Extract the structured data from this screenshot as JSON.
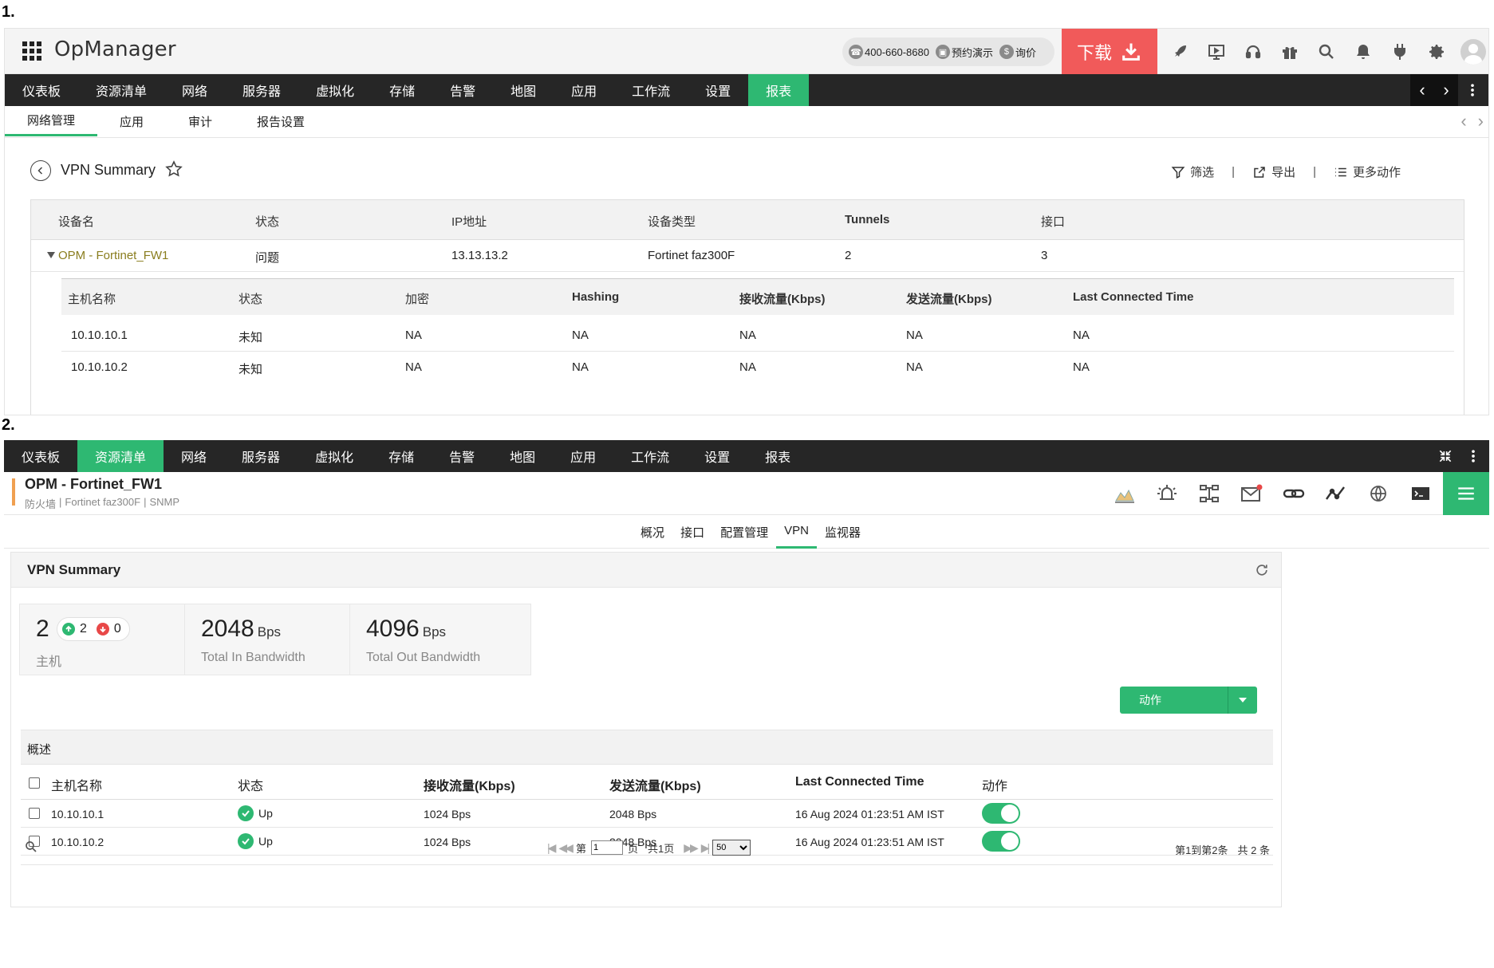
{
  "section_labels": {
    "first": "1.",
    "second": "2."
  },
  "app": {
    "title": "OpManager"
  },
  "contact": {
    "phone": "400-660-8680",
    "demo": "预约演示",
    "price": "询价"
  },
  "download": {
    "label": "下载"
  },
  "nav": {
    "items": [
      "仪表板",
      "资源清单",
      "网络",
      "服务器",
      "虚拟化",
      "存储",
      "告警",
      "地图",
      "应用",
      "工作流",
      "设置",
      "报表"
    ],
    "active_first": "报表",
    "active_second": "资源清单"
  },
  "subnav": {
    "items": [
      "网络管理",
      "应用",
      "审计",
      "报告设置"
    ],
    "active": "网络管理"
  },
  "vpn_page": {
    "title": "VPN Summary",
    "filter": "筛选",
    "export": "导出",
    "more": "更多动作",
    "columns": [
      "设备名",
      "状态",
      "IP地址",
      "设备类型",
      "Tunnels",
      "接口"
    ],
    "device": {
      "name": "OPM - Fortinet_FW1",
      "status": "问题",
      "ip": "13.13.13.2",
      "type": "Fortinet faz300F",
      "tunnels": "2",
      "interfaces": "3"
    },
    "sub_columns": [
      "主机名称",
      "状态",
      "加密",
      "Hashing",
      "接收流量(Kbps)",
      "发送流量(Kbps)",
      "Last Connected Time"
    ],
    "sub_rows": [
      [
        "10.10.10.1",
        "未知",
        "NA",
        "NA",
        "NA",
        "NA",
        "NA"
      ],
      [
        "10.10.10.2",
        "未知",
        "NA",
        "NA",
        "NA",
        "NA",
        "NA"
      ]
    ]
  },
  "device_page": {
    "title": "OPM - Fortinet_FW1",
    "category": "防火墙",
    "model": "Fortinet faz300F",
    "protocol": "SNMP",
    "tabs": [
      "概况",
      "接口",
      "配置管理",
      "VPN",
      "监视器"
    ],
    "active_tab": "VPN",
    "panel_title": "VPN Summary",
    "cards": {
      "hosts": {
        "value": "2",
        "up": "2",
        "down": "0",
        "label": "主机"
      },
      "in": {
        "value": "2048",
        "unit": "Bps",
        "label": "Total In Bandwidth"
      },
      "out": {
        "value": "4096",
        "unit": "Bps",
        "label": "Total Out Bandwidth"
      }
    },
    "action_button": "动作",
    "overview_label": "概述",
    "columns": [
      "主机名称",
      "状态",
      "接收流量(Kbps)",
      "发送流量(Kbps)",
      "Last Connected Time",
      "动作"
    ],
    "rows": [
      {
        "host": "10.10.10.1",
        "status": "Up",
        "rx": "1024 Bps",
        "tx": "2048 Bps",
        "last": "16 Aug 2024 01:23:51 AM IST",
        "enabled": true
      },
      {
        "host": "10.10.10.2",
        "status": "Up",
        "rx": "1024 Bps",
        "tx": "2048 Bps",
        "last": "16 Aug 2024 01:23:51 AM IST",
        "enabled": true
      }
    ],
    "pager": {
      "page_prefix": "第",
      "page_value": "1",
      "page_suffix": "页",
      "total_pages": "共1页",
      "page_size": "50",
      "range": "第1到第2条",
      "total": "共 2 条"
    }
  },
  "colors": {
    "accent_green": "#2eb872",
    "download_red": "#f15a5a",
    "nav_dark": "#262626",
    "device_link": "#8a7d1e"
  }
}
